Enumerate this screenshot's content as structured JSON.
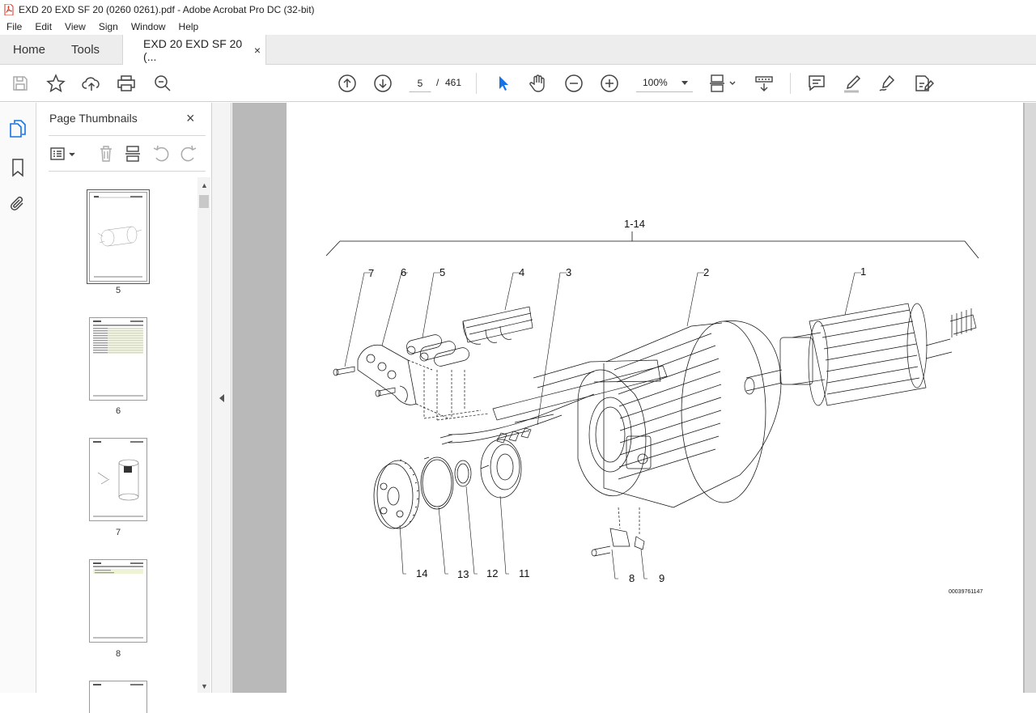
{
  "window": {
    "title": "EXD 20 EXD SF 20 (0260 0261).pdf - Adobe Acrobat Pro DC (32-bit)"
  },
  "menu": [
    "File",
    "Edit",
    "View",
    "Sign",
    "Window",
    "Help"
  ],
  "tabs": {
    "home": "Home",
    "tools": "Tools",
    "document": "EXD 20 EXD SF 20 (...",
    "close": "×"
  },
  "toolbar": {
    "page_current": "5",
    "page_sep": "/",
    "page_total": "461",
    "zoom": "100%"
  },
  "thumbnails": {
    "title": "Page Thumbnails",
    "close": "×",
    "pages": [
      {
        "label": "5"
      },
      {
        "label": "6"
      },
      {
        "label": "7"
      },
      {
        "label": "8"
      }
    ]
  },
  "drawing": {
    "assembly_label": "1-14",
    "callouts": [
      "1",
      "2",
      "3",
      "4",
      "5",
      "6",
      "7",
      "8",
      "9",
      "11",
      "12",
      "13",
      "14"
    ],
    "figure_id": "00039761147"
  },
  "colors": {
    "accent": "#1473e6",
    "viewer_bg": "#b9b9b9",
    "tab_bg": "#ededed"
  }
}
